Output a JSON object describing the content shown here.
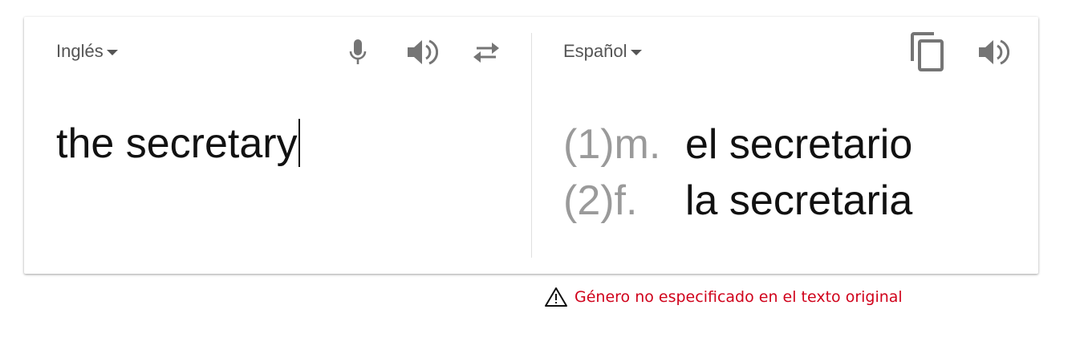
{
  "source": {
    "language": "Inglés",
    "text": "the secretary",
    "icons": [
      "microphone-icon",
      "speaker-icon",
      "swap-languages-icon"
    ]
  },
  "target": {
    "language": "Español",
    "icons": [
      "copy-icon",
      "speaker-icon"
    ],
    "translations": [
      {
        "tag": "(1)m.",
        "text": "el secretario"
      },
      {
        "tag": "(2)f.",
        "text": "la secretaria"
      }
    ]
  },
  "warning": {
    "icon": "warning-triangle-icon",
    "text": "Género no especificado en el texto original",
    "color": "#d0021b"
  }
}
